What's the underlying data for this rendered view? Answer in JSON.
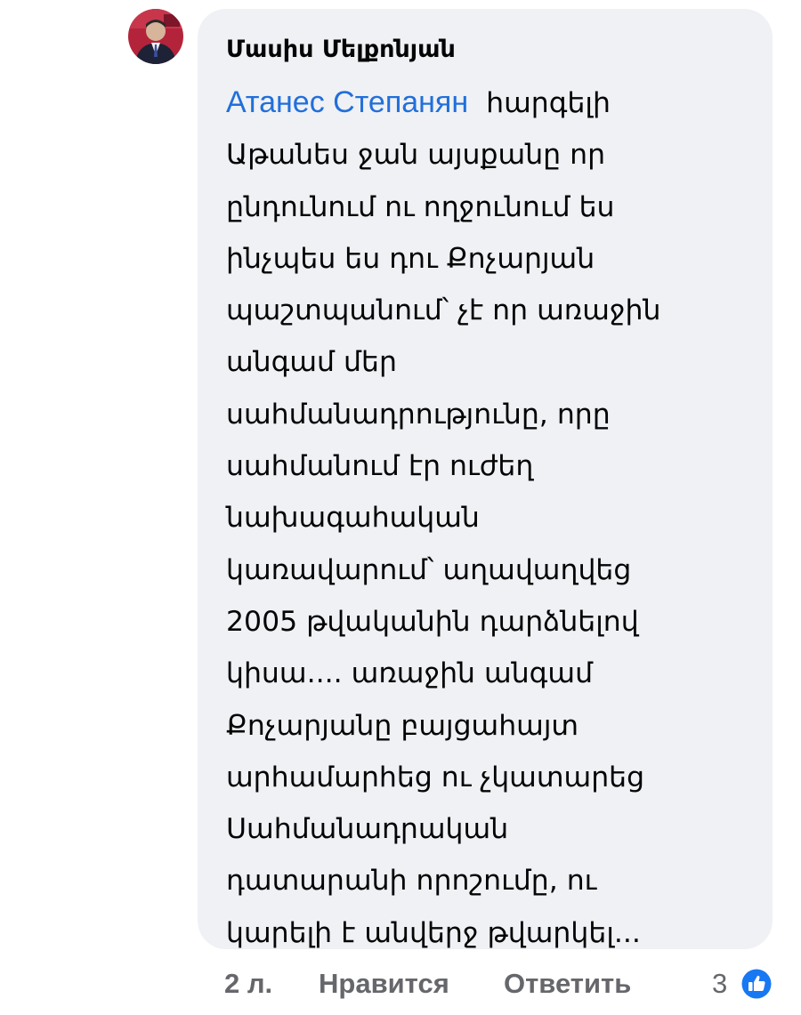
{
  "comment": {
    "author": "Մասիս Մելքոնյան",
    "mention": "Атанес Степанян",
    "lines": [
      "հարգելի",
      "Աթանես ջան այսքանը որ",
      "ընդունում ու ողջունում ես",
      "ինչպես ես դու Քոչարյան",
      "պաշտպանում՝ չէ որ առաջին",
      "անգամ մեր",
      "սահմանադրությունը, որը",
      "սահմանում էր ուժեղ",
      "նախագահական",
      "կառավարում՝ աղավաղվեց",
      "2005 թվականին դարձնելով",
      "կիսա.... առաջին անգամ",
      "Քոչարյանը բայցահայտ",
      "արհամարհեց ու չկատարեց",
      "Սահմանադրական",
      "դատարանի որոշումը, ու",
      "կարելի է անվերջ թվարկել..."
    ]
  },
  "actions": {
    "time": "2 л.",
    "like": "Нравится",
    "reply": "Ответить",
    "reaction_count": "3"
  },
  "icons": {
    "avatar": "user-avatar",
    "reaction": "thumbs-up-icon"
  },
  "colors": {
    "mention": "#216fdb",
    "bubble": "#eff1f4",
    "like_badge": "#1877f2",
    "action_text": "#65676b"
  }
}
